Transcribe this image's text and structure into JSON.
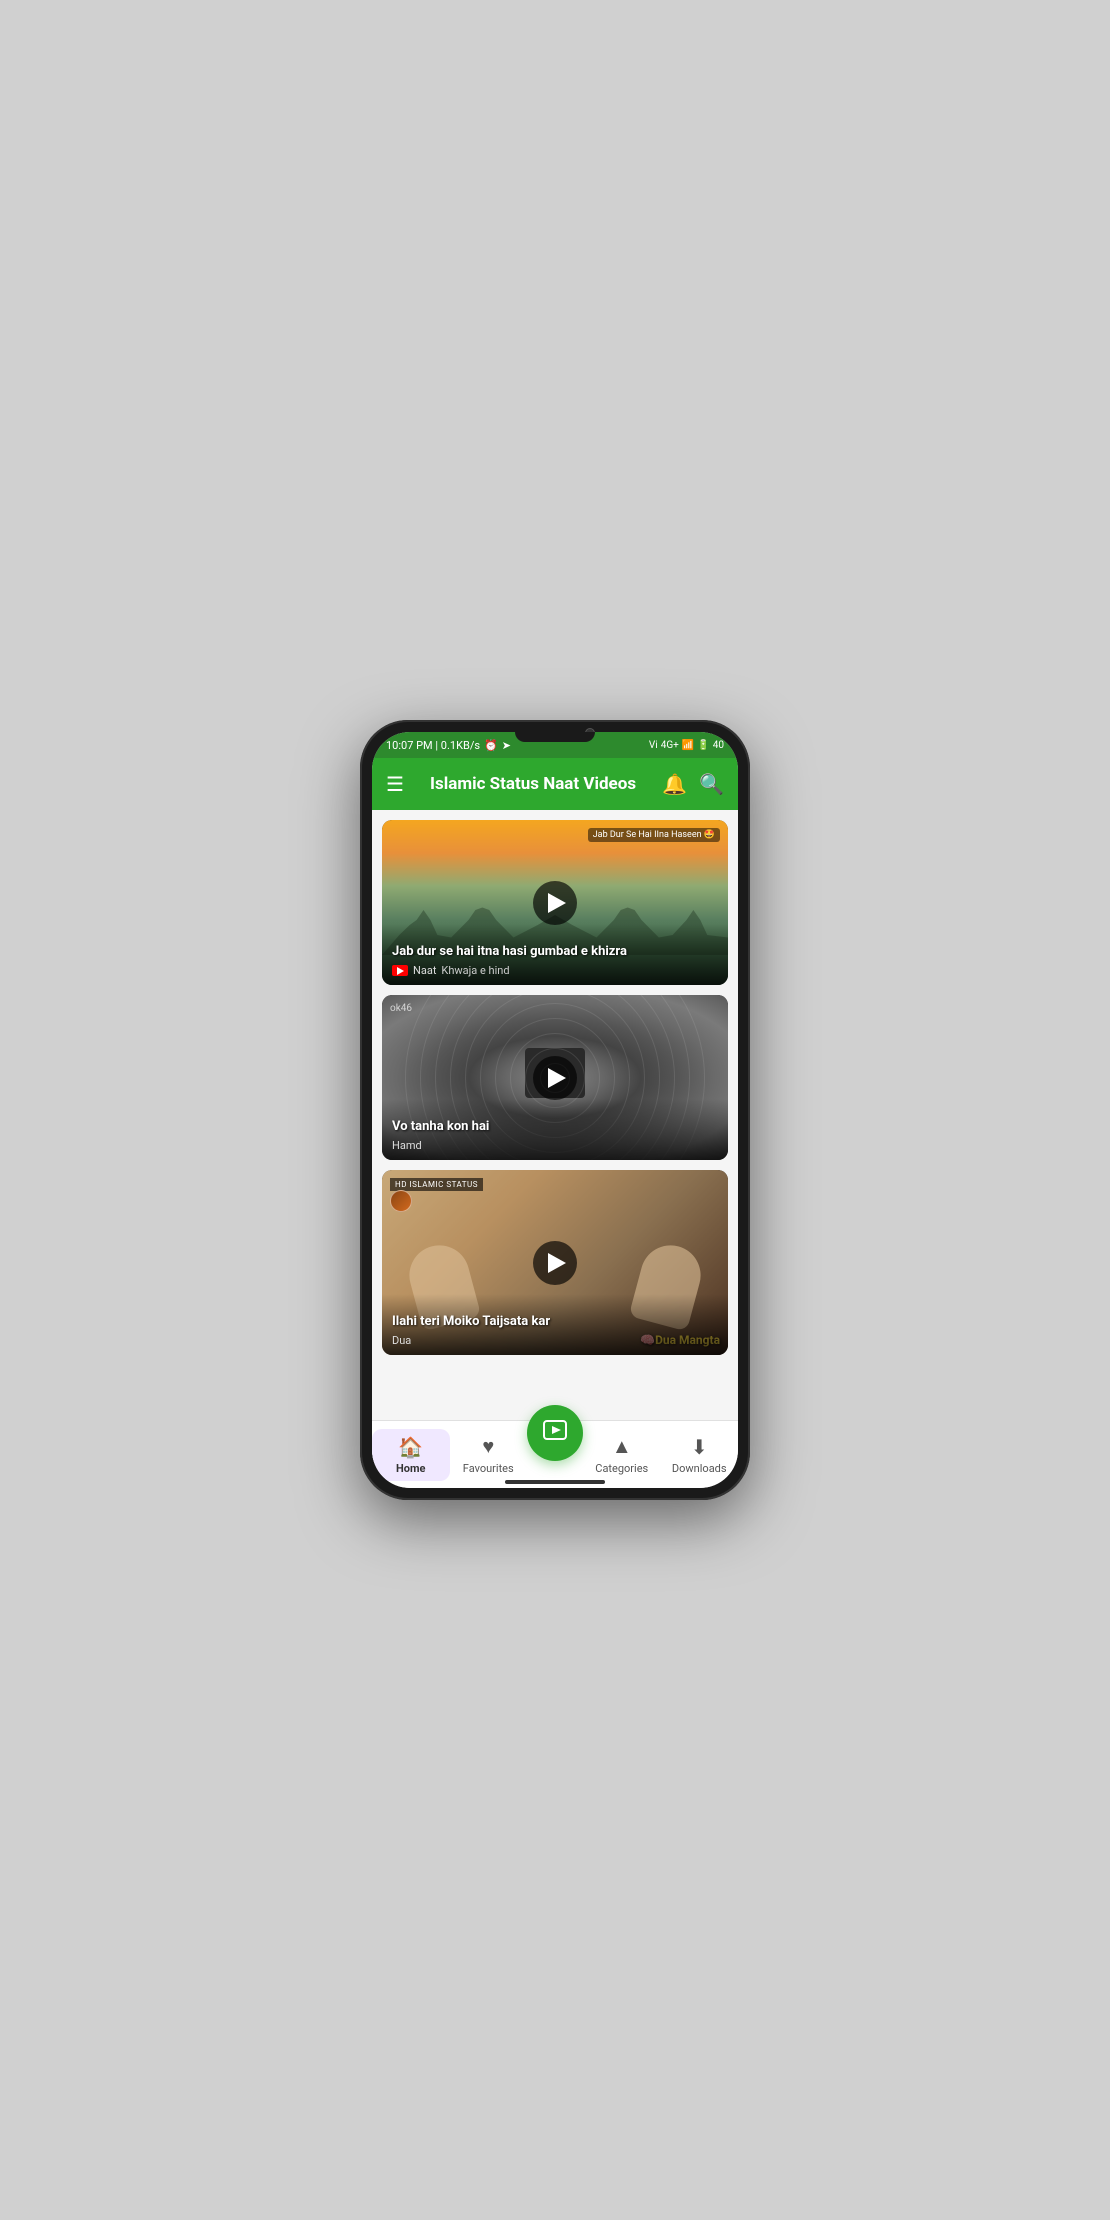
{
  "status_bar": {
    "time": "10:07 PM | 0.1KB/s",
    "icons_left": "alarm clock navigation",
    "network": "4G+",
    "battery": "40"
  },
  "header": {
    "title": "Islamic Status Naat Videos",
    "menu_icon": "hamburger",
    "bell_icon": "notification bell",
    "search_icon": "search magnifier"
  },
  "videos": [
    {
      "id": 1,
      "title": "Jab dur se hai itna hasi gumbad e khizra",
      "overlay_title": "Jab Dur Se Hai IIna Haseen 🤩",
      "category": "Naat",
      "channel": "Khwaja e hind",
      "has_yt_icon": true,
      "watermark": ""
    },
    {
      "id": 2,
      "title": "Vo tanha kon hai",
      "overlay_title": "",
      "category": "Hamd",
      "channel": "",
      "has_yt_icon": false,
      "watermark": "ok46"
    },
    {
      "id": 3,
      "title": "Ilahi teri Moiko Taijsata kar",
      "overlay_title": "",
      "category": "Dua",
      "channel": "",
      "has_yt_icon": false,
      "watermark": "HD ISLAMIC STATUS",
      "dua_text": "🧠Dua Mangta"
    }
  ],
  "bottom_nav": {
    "home_label": "Home",
    "home_icon": "🏠",
    "favourites_label": "Favourites",
    "favourites_icon": "♥",
    "center_icon": "▶",
    "categories_label": "Categories",
    "categories_icon": "▲",
    "downloads_label": "Downloads",
    "downloads_icon": "⬇"
  },
  "colors": {
    "primary_green": "#2ea82e",
    "dark_green": "#2d8a2d",
    "white": "#ffffff"
  }
}
